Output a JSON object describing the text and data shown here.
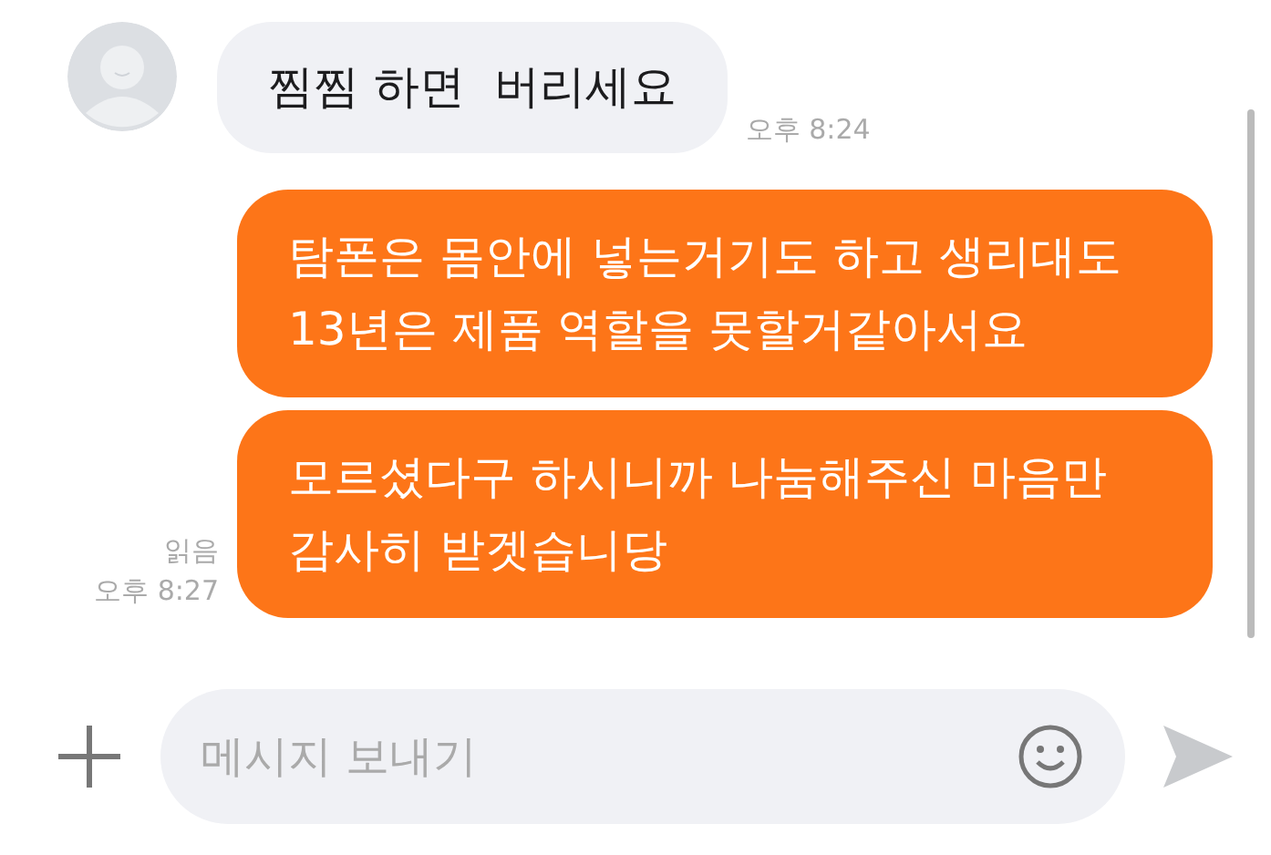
{
  "messages": [
    {
      "kind": "incoming",
      "text": "찜찜 하면  버리세요",
      "time": "오후 8:24"
    },
    {
      "kind": "outgoing",
      "text": "탐폰은 몸안에 넣는거기도 하고 생리대도\n13년은 제품 역할을 못할거같아서요"
    },
    {
      "kind": "outgoing",
      "text": "모르셨다구 하시니까 나눔해주신 마음만\n감사히 받겟습니당",
      "read": "읽음",
      "time": "오후 8:27"
    }
  ],
  "composer": {
    "placeholder": "메시지 보내기",
    "send_disabled": true
  }
}
